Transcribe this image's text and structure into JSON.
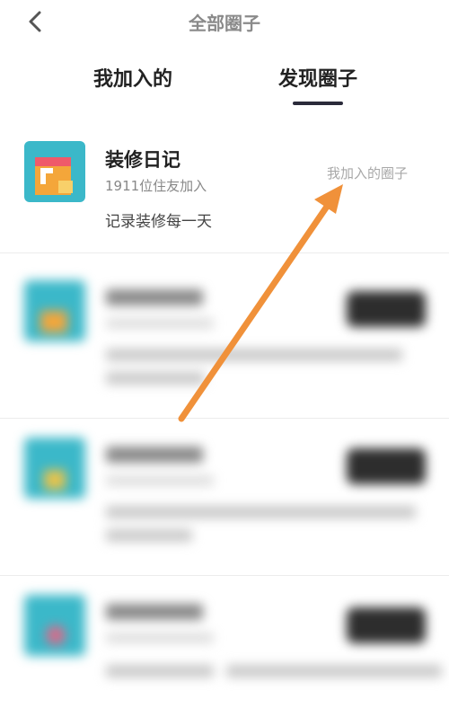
{
  "header": {
    "title": "全部圈子",
    "back_icon": "chevron-left-icon"
  },
  "tabs": [
    {
      "label": "我加入的",
      "active": false
    },
    {
      "label": "发现圈子",
      "active": true
    }
  ],
  "circles": [
    {
      "name": "装修日记",
      "members": "1911位住友加入",
      "description": "记录装修每一天",
      "status": "我加入的圈子",
      "blurred": false
    }
  ],
  "colors": {
    "annotation_arrow": "#f0913a",
    "tab_underline": "#2a2a3a",
    "avatar_teal": "#3bb8c9",
    "avatar_orange": "#f4a63a",
    "join_button": "#2d2d2d"
  }
}
